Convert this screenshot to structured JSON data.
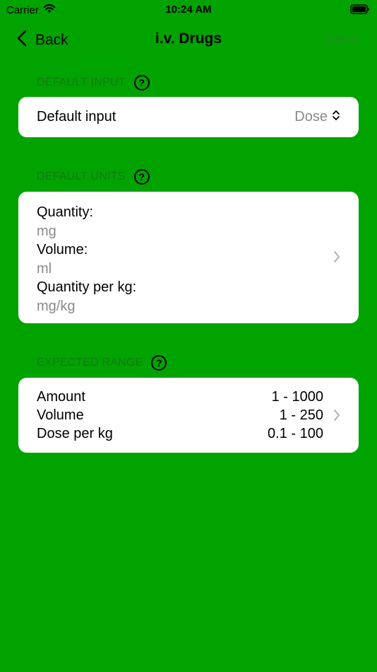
{
  "status": {
    "carrier": "Carrier",
    "time": "10:24 AM"
  },
  "nav": {
    "back_label": "Back",
    "title": "i.v. Drugs",
    "save_label": "Save"
  },
  "sections": {
    "default_input": {
      "header": "DEFAULT INPUT",
      "row_label": "Default input",
      "row_value": "Dose"
    },
    "default_units": {
      "header": "DEFAULT UNITS",
      "items": [
        {
          "label": "Quantity:",
          "value": "mg"
        },
        {
          "label": "Volume:",
          "value": "ml"
        },
        {
          "label": "Quantity per kg:",
          "value": "mg/kg"
        }
      ]
    },
    "expected_range": {
      "header": "EXPECTED RANGE",
      "rows": [
        {
          "label": "Amount",
          "value": "1 - 1000"
        },
        {
          "label": "Volume",
          "value": "1 - 250"
        },
        {
          "label": "Dose per kg",
          "value": "0.1 - 100"
        }
      ]
    }
  },
  "colors": {
    "background": "#00a300",
    "card": "#ffffff",
    "muted": "#8a8a8a"
  }
}
